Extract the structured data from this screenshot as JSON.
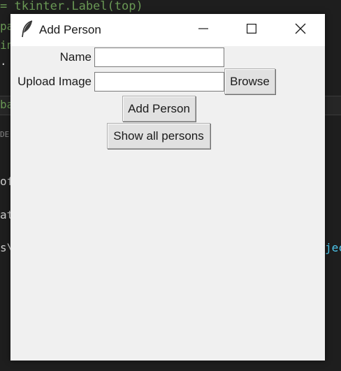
{
  "editor": {
    "top_line": "= tkinter.Label(top)",
    "left_fragments": [
      "pa",
      "in",
      ".",
      "ba",
      "DE",
      "of",
      "at",
      "s\\"
    ],
    "right_fragment": "jec"
  },
  "window": {
    "title": "Add Person",
    "icon": "feather-icon",
    "controls": {
      "minimize": "minimize-icon",
      "maximize": "maximize-icon",
      "close": "close-icon"
    }
  },
  "form": {
    "name_label": "Name",
    "name_value": "",
    "upload_label": "Upload Image",
    "upload_value": "",
    "browse_label": "Browse",
    "add_person_label": "Add Person",
    "show_all_label": "Show all persons"
  },
  "colors": {
    "window_bg": "#f0f0f0",
    "titlebar_bg": "#ffffff",
    "button_bg": "#e1e1e1",
    "editor_bg": "#1e1e1e",
    "code_green": "#6a9955",
    "code_blue": "#4ec9f0"
  }
}
